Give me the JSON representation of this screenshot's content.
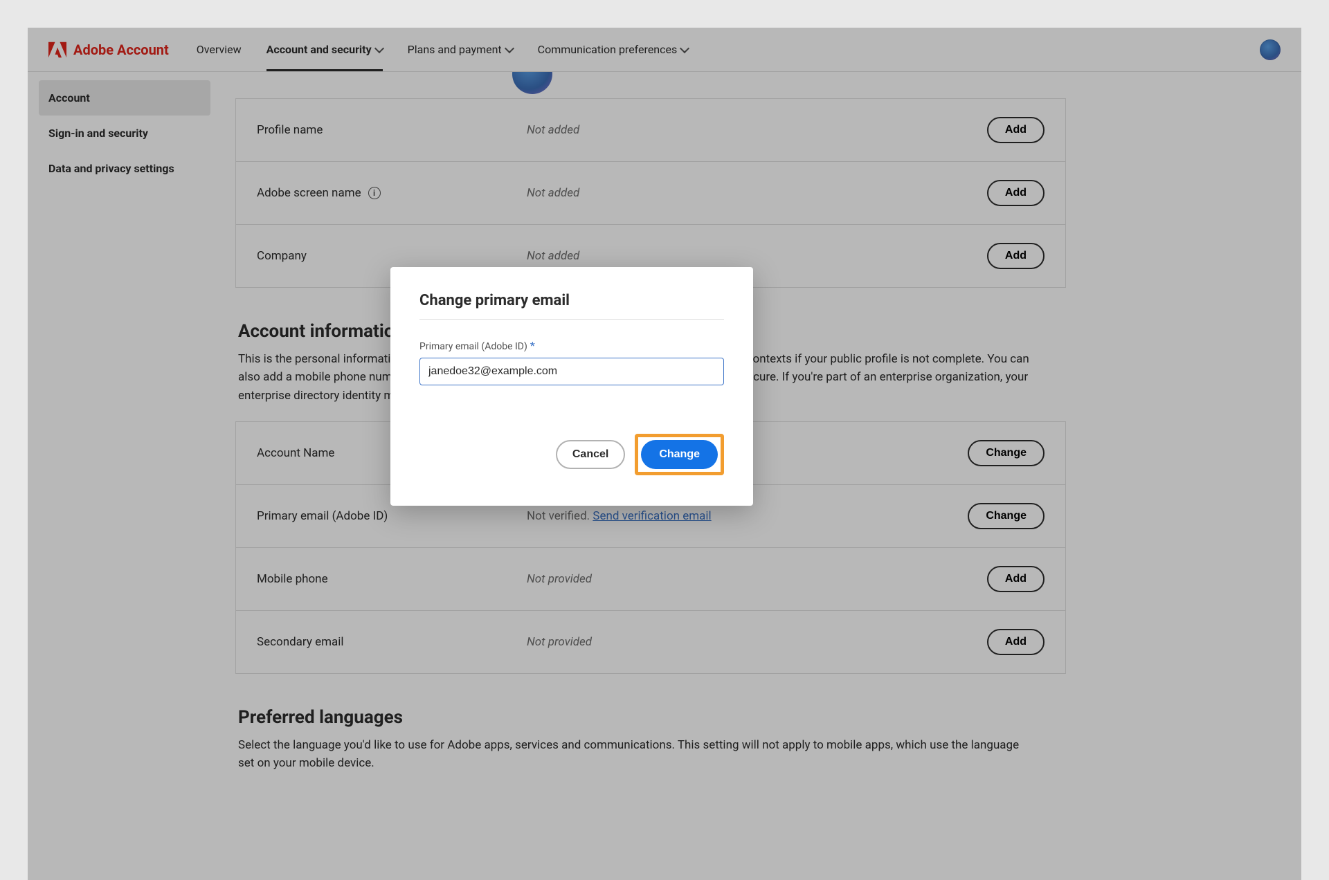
{
  "brand": "Adobe Account",
  "nav": {
    "overview": "Overview",
    "account_security": "Account and security",
    "plans_payment": "Plans and payment",
    "comm_prefs": "Communication preferences"
  },
  "sidebar": {
    "account": "Account",
    "signin_security": "Sign-in and security",
    "data_privacy": "Data and privacy settings"
  },
  "fields": {
    "profile_name": {
      "label": "Profile name",
      "value": "Not added",
      "action": "Add"
    },
    "screen_name": {
      "label": "Adobe screen name",
      "value": "Not added",
      "action": "Add"
    },
    "company": {
      "label": "Company",
      "value": "Not added",
      "action": "Add"
    }
  },
  "section1": {
    "title": "Account information a",
    "desc": "This is the personal information you use to access your account. It may be visible in collaborative contexts if your public profile is not complete. You can also add a mobile phone number and secondary email to help keep your account connected and secure. If you're part of an enterprise organization, your enterprise directory identity may be used in collaborative contexts."
  },
  "account_fields": {
    "account_name": {
      "label": "Account Name",
      "value": "",
      "action": "Change"
    },
    "primary_email": {
      "label": "Primary email (Adobe ID)",
      "status": "Not verified.",
      "link": "Send verification email",
      "action": "Change"
    },
    "mobile_phone": {
      "label": "Mobile phone",
      "value": "Not provided",
      "action": "Add"
    },
    "secondary_email": {
      "label": "Secondary email",
      "value": "Not provided",
      "action": "Add"
    }
  },
  "section2": {
    "title": "Preferred languages",
    "desc": "Select the language you'd like to use for Adobe apps, services and communications. This setting will not apply to mobile apps, which use the language set on your mobile device."
  },
  "modal": {
    "title": "Change primary email",
    "label": "Primary email (Adobe ID)",
    "value": "janedoe32@example.com",
    "cancel": "Cancel",
    "change": "Change"
  }
}
